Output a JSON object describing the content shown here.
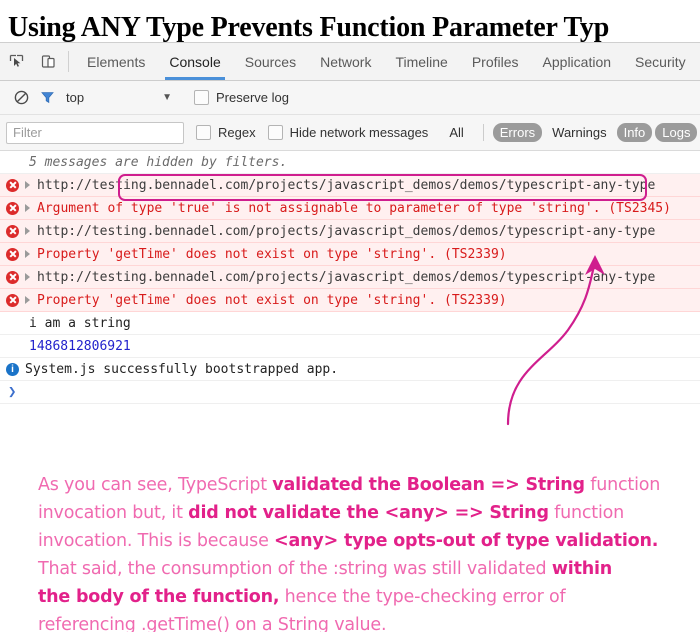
{
  "page_title": "Using ANY Type Prevents Function Parameter Typ",
  "colors": {
    "accent_tab": "#4a90d9",
    "error_text": "#d81b1b",
    "error_row_bg": "#fff0f0",
    "annotation_pink": "#f06ab0",
    "annotation_pink_bold": "#e2218a",
    "highlight_box": "#cf1e8e",
    "number_blue": "#2222cc",
    "info_blue": "#1a73c8"
  },
  "devtools": {
    "toolbar_icons": [
      {
        "name": "inspect-element-icon",
        "label": "Inspect element"
      },
      {
        "name": "device-toolbar-icon",
        "label": "Toggle device toolbar"
      }
    ],
    "tabs": [
      {
        "label": "Elements",
        "active": false
      },
      {
        "label": "Console",
        "active": true
      },
      {
        "label": "Sources",
        "active": false
      },
      {
        "label": "Network",
        "active": false
      },
      {
        "label": "Timeline",
        "active": false
      },
      {
        "label": "Profiles",
        "active": false
      },
      {
        "label": "Application",
        "active": false
      },
      {
        "label": "Security",
        "active": false
      }
    ],
    "context_row": {
      "clear_icon": "clear-console-icon",
      "filter_icon": "filter-funnel-icon",
      "context_value": "top",
      "caret": "▼",
      "preserve_log_label": "Preserve log",
      "preserve_log_checked": false
    },
    "filter_row": {
      "filter_placeholder": "Filter",
      "filter_value": "",
      "regex_label": "Regex",
      "regex_checked": false,
      "hide_network_label": "Hide network messages",
      "hide_network_checked": false,
      "levels": [
        {
          "label": "All",
          "active": false
        },
        {
          "label": "Errors",
          "active": true
        },
        {
          "label": "Warnings",
          "active": false
        },
        {
          "label": "Info",
          "active": true
        },
        {
          "label": "Logs",
          "active": true
        }
      ]
    },
    "console": {
      "hidden_notice": "5 messages are hidden by filters.",
      "messages": [
        {
          "type": "error",
          "expandable": true,
          "text": "http://testing.bennadel.com/projects/javascript_demos/demos/typescript-any-type",
          "style": "url"
        },
        {
          "type": "error",
          "expandable": true,
          "text": "Argument of type 'true' is not assignable to parameter of type 'string'. (TS2345)",
          "style": "error"
        },
        {
          "type": "error",
          "expandable": true,
          "text": "http://testing.bennadel.com/projects/javascript_demos/demos/typescript-any-type",
          "style": "url"
        },
        {
          "type": "error",
          "expandable": true,
          "text": "Property 'getTime' does not exist on type 'string'. (TS2339)",
          "style": "error"
        },
        {
          "type": "error",
          "expandable": true,
          "text": "http://testing.bennadel.com/projects/javascript_demos/demos/typescript-any-type",
          "style": "url"
        },
        {
          "type": "error",
          "expandable": true,
          "text": "Property 'getTime' does not exist on type 'string'. (TS2339)",
          "style": "error"
        },
        {
          "type": "log",
          "expandable": false,
          "text": "i am a string",
          "style": "plain"
        },
        {
          "type": "log",
          "expandable": false,
          "text": "1486812806921",
          "style": "number"
        },
        {
          "type": "info",
          "expandable": false,
          "text": "System.js successfully bootstrapped app.",
          "style": "plain"
        }
      ],
      "prompt_symbol": "❯"
    }
  },
  "annotations": {
    "highlight_box_label": "type 'true' is not assignable to parameter of type 'string'.",
    "arrow_label": "curved-arrow-pointing-to-error",
    "note_lines": [
      [
        {
          "t": "As you can see, TypeScript ",
          "b": false
        },
        {
          "t": "validated the Boolean => String",
          "b": true
        },
        {
          "t": " function",
          "b": false
        }
      ],
      [
        {
          "t": "invocation but, it ",
          "b": false
        },
        {
          "t": "did not validate the <any> => String",
          "b": true
        },
        {
          "t": " function",
          "b": false
        }
      ],
      [
        {
          "t": "invocation. This is because ",
          "b": false
        },
        {
          "t": "<any> type opts-out of type validation.",
          "b": true
        }
      ],
      [
        {
          "t": "That said, the consumption of the :string was still validated ",
          "b": false
        },
        {
          "t": "within",
          "b": true
        }
      ],
      [
        {
          "t": "the body of the function,",
          "b": true
        },
        {
          "t": " hence the type-checking error of",
          "b": false
        }
      ],
      [
        {
          "t": "referencing .getTime() on a String value.",
          "b": false
        }
      ]
    ]
  }
}
